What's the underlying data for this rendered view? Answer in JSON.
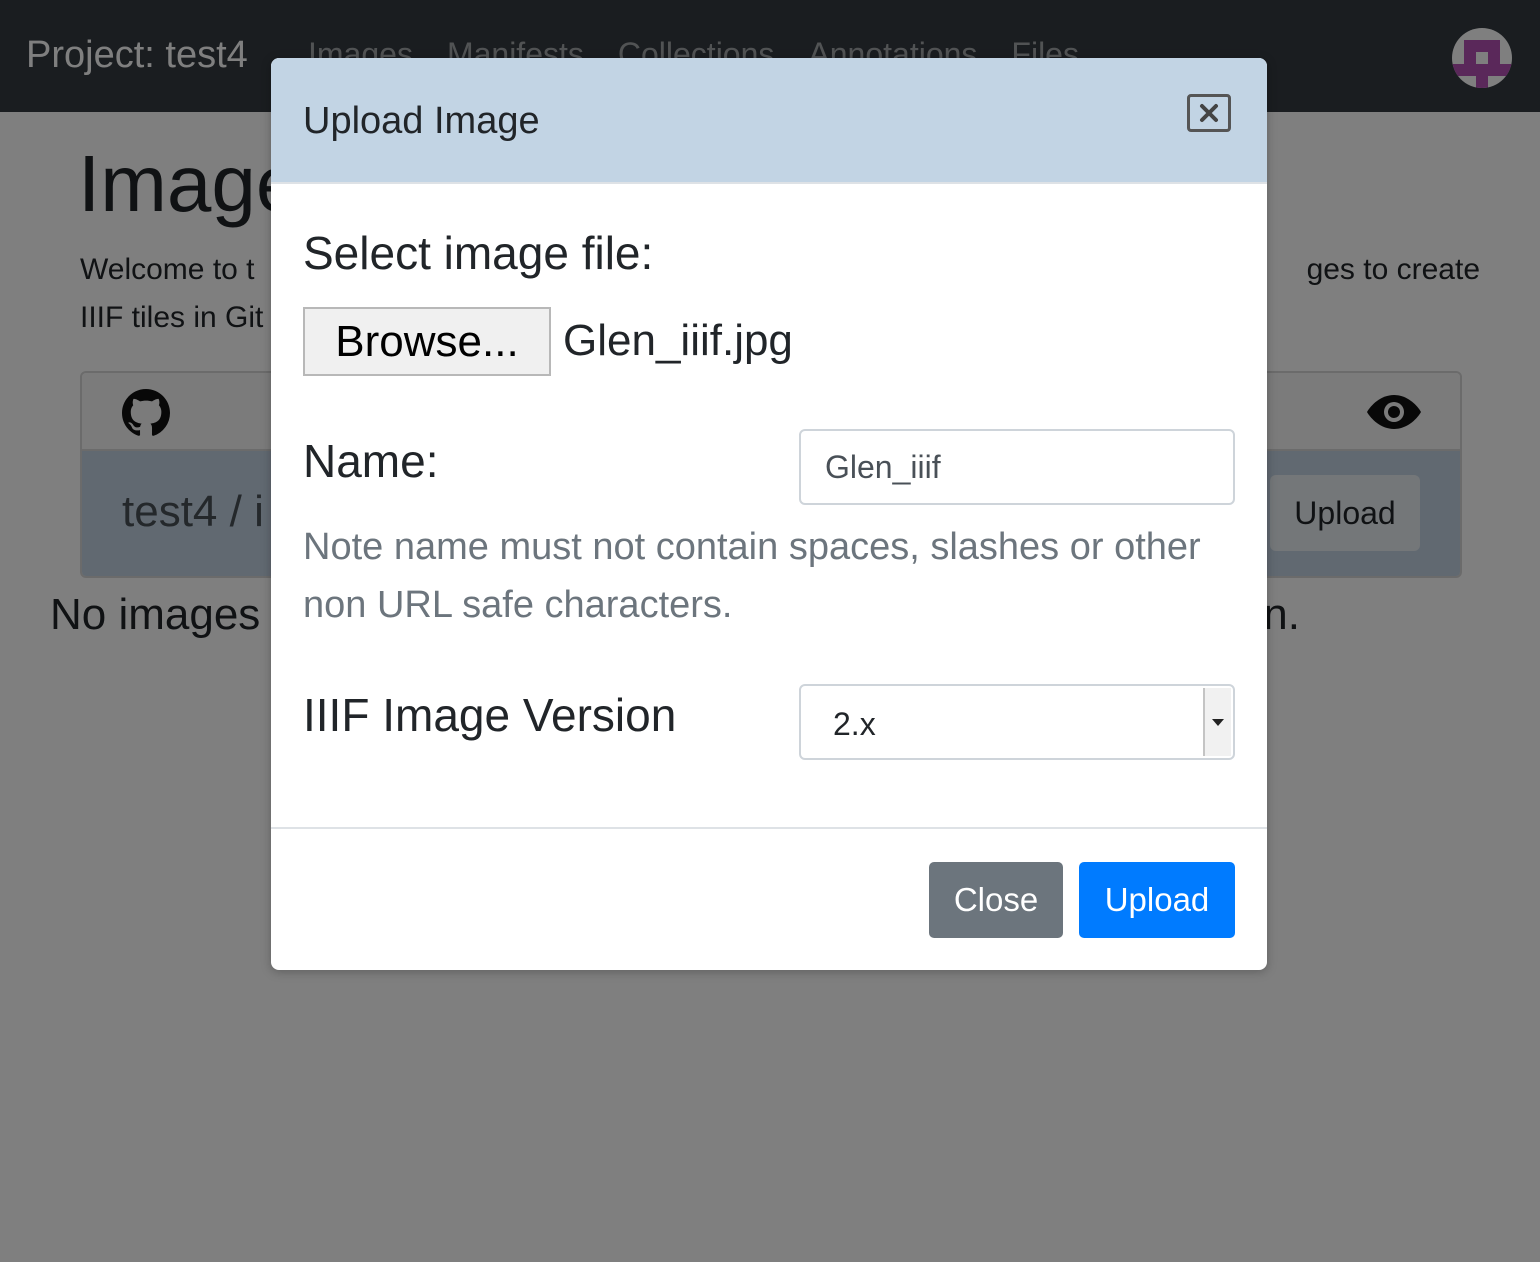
{
  "navbar": {
    "brand": "Project: test4",
    "links": [
      "Images",
      "Manifests",
      "Collections",
      "Annotations",
      "Files"
    ]
  },
  "page": {
    "title": "Image",
    "intro_left_line1": "Welcome to t",
    "intro_right_line1": "ges to create",
    "intro_left_line2": "IIIF tiles in Git",
    "repo_path": "test4 / i",
    "upload_label": "Upload",
    "no_images_left": "No images",
    "no_images_right": "n."
  },
  "modal": {
    "title": "Upload Image",
    "select_file_label": "Select image file:",
    "browse_label": "Browse...",
    "file_name": "Glen_iiif.jpg",
    "name_label": "Name:",
    "name_value": "Glen_iiif",
    "note": "Note name must not contain spaces, slashes or other non URL safe characters.",
    "version_label": "IIIF Image Version",
    "version_value": "2.x",
    "close_label": "Close",
    "upload_label": "Upload"
  },
  "colors": {
    "navbar": "#343a40",
    "modal_header": "#c2d4e4",
    "primary": "#007bff",
    "secondary": "#6c757d"
  }
}
